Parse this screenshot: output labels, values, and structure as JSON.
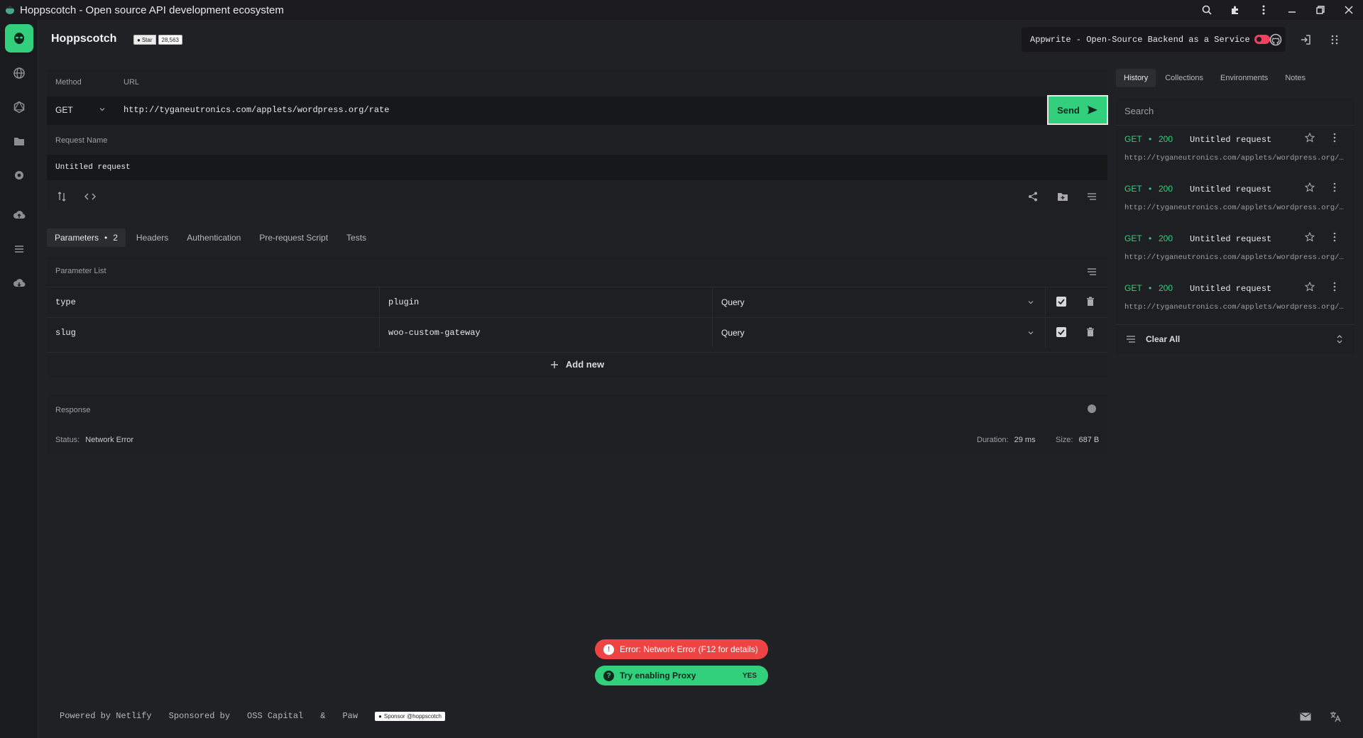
{
  "window": {
    "title": "Hoppscotch - Open source API development ecosystem"
  },
  "header": {
    "brand": "Hoppscotch",
    "github_star_label": "Star",
    "github_star_count": "28,563",
    "appwrite_banner": "Appwrite - Open-Source Backend as a Service"
  },
  "request": {
    "method_label": "Method",
    "url_label": "URL",
    "method": "GET",
    "url": "http://tyganeutronics.com/applets/wordpress.org/rate",
    "send_label": "Send",
    "name_label": "Request Name",
    "name_value": "Untitled request"
  },
  "tabs": [
    {
      "label": "Parameters",
      "badge": "2"
    },
    {
      "label": "Headers"
    },
    {
      "label": "Authentication"
    },
    {
      "label": "Pre-request Script"
    },
    {
      "label": "Tests"
    }
  ],
  "params": {
    "title": "Parameter List",
    "rows": [
      {
        "key": "type",
        "value": "plugin",
        "type": "Query"
      },
      {
        "key": "slug",
        "value": "woo-custom-gateway",
        "type": "Query"
      }
    ],
    "add_label": "Add new"
  },
  "response": {
    "title": "Response",
    "status_label": "Status:",
    "status_value": "Network Error",
    "duration_label": "Duration:",
    "duration_value": "29 ms",
    "size_label": "Size:",
    "size_value": "687 B"
  },
  "side": {
    "tabs": [
      "History",
      "Collections",
      "Environments",
      "Notes"
    ],
    "search_placeholder": "Search",
    "history": [
      {
        "method": "GET",
        "status": "200",
        "name": "Untitled request",
        "url": "http://tyganeutronics.com/applets/wordpress.org/rate"
      },
      {
        "method": "GET",
        "status": "200",
        "name": "Untitled request",
        "url": "http://tyganeutronics.com/applets/wordpress.org/rate"
      },
      {
        "method": "GET",
        "status": "200",
        "name": "Untitled request",
        "url": "http://tyganeutronics.com/applets/wordpress.org/rate"
      },
      {
        "method": "GET",
        "status": "200",
        "name": "Untitled request",
        "url": "http://tyganeutronics.com/applets/wordpress.org/rate"
      }
    ],
    "clear_all": "Clear All"
  },
  "toasts": {
    "error": "Error: Network Error (F12 for details)",
    "proxy": "Try enabling Proxy",
    "proxy_action": "YES"
  },
  "footer": {
    "powered": "Powered by Netlify",
    "sponsored": "Sponsored by",
    "oss": "OSS Capital",
    "amp": "&",
    "paw": "Paw",
    "sponsor_button": "Sponsor @hoppscotch"
  },
  "colors": {
    "accent": "#32d07d",
    "error": "#ef4444",
    "background": "#202124"
  }
}
